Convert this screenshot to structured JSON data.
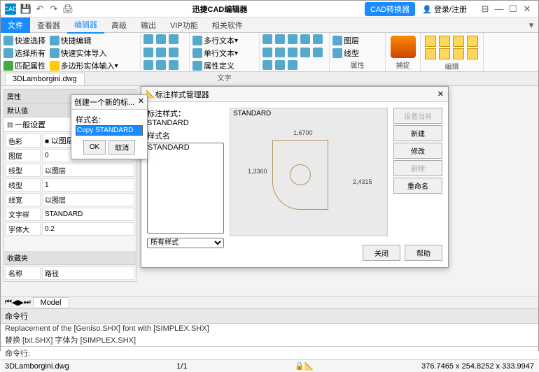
{
  "titlebar": {
    "app_icon": "CAD",
    "title": "迅捷CAD编辑器",
    "convert_btn": "CAD转换器",
    "login": "登录/注册"
  },
  "menutabs": [
    "文件",
    "查看器",
    "编辑器",
    "高级",
    "输出",
    "VIP功能",
    "相关软件"
  ],
  "menutabs_active": 0,
  "menutabs_current": 2,
  "ribbon": {
    "g1": {
      "a": "快速选择",
      "b": "选择所有",
      "c": "匹配属性",
      "d": "快捷编辑",
      "e": "快速实体导入",
      "f": "多边形实体输入"
    },
    "g2": {
      "a": "多行文本",
      "b": "单行文本",
      "c": "属性定义",
      "label": "文字"
    },
    "g3": {
      "a": "图层",
      "b": "线型",
      "label": "属性"
    },
    "g4": {
      "label": "捕捉"
    },
    "g5": {
      "label": "编辑"
    }
  },
  "filetab": "3DLamborgini.dwg",
  "props": {
    "title": "属性",
    "default": "默认值",
    "group": "一般设置",
    "rows": [
      [
        "色彩",
        "以图层"
      ],
      [
        "图层",
        "0"
      ],
      [
        "线型",
        "以图层"
      ],
      [
        "线型",
        "1"
      ],
      [
        "线宽",
        "以图层"
      ],
      [
        "文字样",
        "STANDARD"
      ],
      [
        "字体大",
        "0.2"
      ]
    ],
    "fav": "收藏夹",
    "name": "名称",
    "path": "路径"
  },
  "dialog": {
    "title": "标注样式管理器",
    "label_style": "标注样式：",
    "current": "STANDARD",
    "label_name": "样式名",
    "list_item": "STANDARD",
    "preview_label": "STANDARD",
    "dims": {
      "a": "1,6700",
      "b": "1,3360",
      "c": "2,4315"
    },
    "filter": "所有样式",
    "buttons": {
      "setcur": "设置当前",
      "new": "新建",
      "modify": "修改",
      "delete": "删除",
      "rename": "重命名"
    },
    "close": "关闭",
    "help": "帮助"
  },
  "popup": {
    "title": "创建一个新的标...",
    "label": "样式名:",
    "value": "Copy STANDARD",
    "ok": "OK",
    "cancel": "取消"
  },
  "bottom": {
    "model": "Model"
  },
  "cmd": {
    "title": "命令行",
    "l1": "Replacement of the [Geniso.SHX] font with [SIMPLEX.SHX]",
    "l2": "替换 [txt.SHX] 字体为 [SIMPLEX.SHX]",
    "prompt": "命令行:"
  },
  "status": {
    "file": "3DLamborgini.dwg",
    "page": "1/1",
    "coord": "376.7465 x 254.8252 x 333.9947"
  }
}
